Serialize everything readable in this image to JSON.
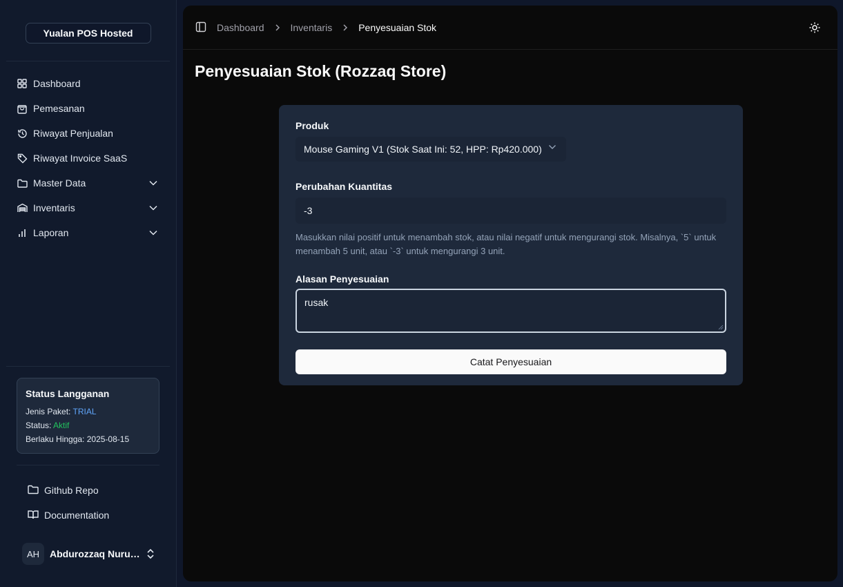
{
  "sidebar": {
    "brand": "Yualan POS Hosted",
    "items": [
      {
        "label": "Dashboard",
        "icon": "grid-icon"
      },
      {
        "label": "Pemesanan",
        "icon": "shopping-bag-icon"
      },
      {
        "label": "Riwayat Penjualan",
        "icon": "history-icon"
      },
      {
        "label": "Riwayat Invoice SaaS",
        "icon": "tag-icon"
      },
      {
        "label": "Master Data",
        "icon": "folder-icon",
        "expandable": true
      },
      {
        "label": "Inventaris",
        "icon": "warehouse-icon",
        "expandable": true
      },
      {
        "label": "Laporan",
        "icon": "bar-chart-icon",
        "expandable": true
      }
    ],
    "subscription": {
      "title": "Status Langganan",
      "plan_label": "Jenis Paket:",
      "plan_value": "TRIAL",
      "status_label": "Status:",
      "status_value": "Aktif",
      "valid_label": "Berlaku Hingga:",
      "valid_value": "2025-08-15"
    },
    "links": [
      {
        "label": "Github Repo",
        "icon": "folder-icon"
      },
      {
        "label": "Documentation",
        "icon": "book-open-icon"
      }
    ],
    "user": {
      "initials": "AH",
      "name": "Abdurozzaq Nurul Hadi"
    }
  },
  "header": {
    "breadcrumbs": [
      "Dashboard",
      "Inventaris",
      "Penyesuaian Stok"
    ]
  },
  "page": {
    "title": "Penyesuaian Stok (Rozzaq Store)"
  },
  "form": {
    "product_label": "Produk",
    "product_value": "Mouse Gaming V1 (Stok Saat Ini: 52, HPP: Rp420.000)",
    "qty_label": "Perubahan Kuantitas",
    "qty_value": "-3",
    "qty_help": "Masukkan nilai positif untuk menambah stok, atau nilai negatif untuk mengurangi stok. Misalnya, `5` untuk menambah 5 unit, atau `-3` untuk mengurangi 3 unit.",
    "reason_label": "Alasan Penyesuaian",
    "reason_value": "rusak",
    "submit_label": "Catat Penyesuaian"
  },
  "colors": {
    "sidebar_bg": "#111a2c",
    "main_bg": "#0a0a0a",
    "card_bg": "#1e293b",
    "plan_color": "#60a5fa",
    "status_color": "#22c55e"
  }
}
